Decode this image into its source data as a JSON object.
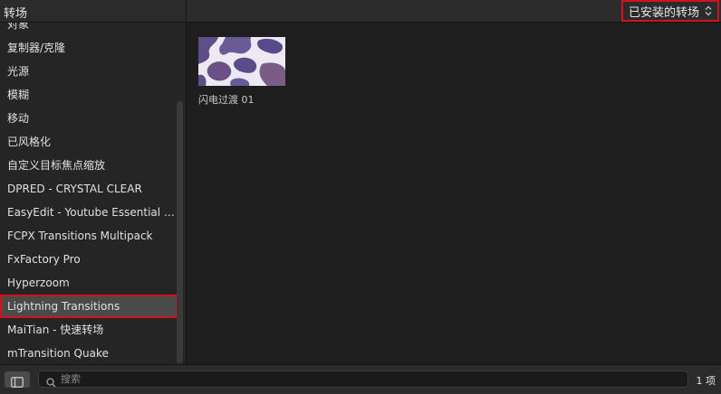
{
  "header": {
    "title": "转场",
    "filter_label": "已安装的转场"
  },
  "sidebar": {
    "items": [
      {
        "label": "对象"
      },
      {
        "label": "复制器/克隆"
      },
      {
        "label": "光源"
      },
      {
        "label": "模糊"
      },
      {
        "label": "移动"
      },
      {
        "label": "已风格化"
      },
      {
        "label": "自定义目标焦点缩放"
      },
      {
        "label": "DPRED - CRYSTAL CLEAR"
      },
      {
        "label": "EasyEdit - Youtube Essential Li..."
      },
      {
        "label": "FCPX Transitions Multipack"
      },
      {
        "label": "FxFactory Pro"
      },
      {
        "label": "Hyperzoom"
      },
      {
        "label": "Lightning Transitions"
      },
      {
        "label": "MaiTian - 快速转场"
      },
      {
        "label": "mTransition Quake"
      }
    ],
    "selected_index": 12
  },
  "browser": {
    "items": [
      {
        "label": "闪电过渡 01"
      }
    ]
  },
  "footer": {
    "search_placeholder": "搜索",
    "count": "1 项"
  },
  "colors": {
    "highlight_border": "#d0141d",
    "selected_bg": "#4a4a4a",
    "thumb_blob": "#5a4a86"
  },
  "icons": {
    "sidebar_toggle": "sidebar-icon",
    "search": "magnifier-icon",
    "filter": "chevron-up-down-icon"
  }
}
